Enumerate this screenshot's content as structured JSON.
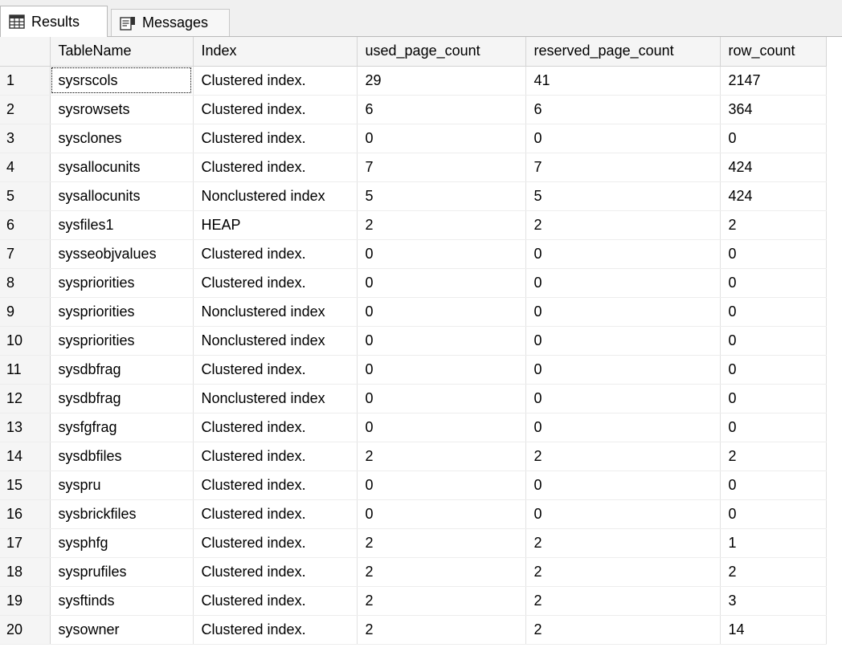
{
  "tabs": {
    "results_label": "Results",
    "messages_label": "Messages"
  },
  "grid": {
    "columns": [
      "TableName",
      "Index",
      "used_page_count",
      "reserved_page_count",
      "row_count"
    ],
    "rows": [
      {
        "n": "1",
        "table": "sysrscols",
        "index": "Clustered index.",
        "used": "29",
        "reserved": "41",
        "rows": "2147"
      },
      {
        "n": "2",
        "table": "sysrowsets",
        "index": "Clustered index.",
        "used": "6",
        "reserved": "6",
        "rows": "364"
      },
      {
        "n": "3",
        "table": "sysclones",
        "index": "Clustered index.",
        "used": "0",
        "reserved": "0",
        "rows": "0"
      },
      {
        "n": "4",
        "table": "sysallocunits",
        "index": "Clustered index.",
        "used": "7",
        "reserved": "7",
        "rows": "424"
      },
      {
        "n": "5",
        "table": "sysallocunits",
        "index": "Nonclustered index",
        "used": "5",
        "reserved": "5",
        "rows": "424"
      },
      {
        "n": "6",
        "table": "sysfiles1",
        "index": "HEAP",
        "used": "2",
        "reserved": "2",
        "rows": "2"
      },
      {
        "n": "7",
        "table": "sysseobjvalues",
        "index": "Clustered index.",
        "used": "0",
        "reserved": "0",
        "rows": "0"
      },
      {
        "n": "8",
        "table": "syspriorities",
        "index": "Clustered index.",
        "used": "0",
        "reserved": "0",
        "rows": "0"
      },
      {
        "n": "9",
        "table": "syspriorities",
        "index": "Nonclustered index",
        "used": "0",
        "reserved": "0",
        "rows": "0"
      },
      {
        "n": "10",
        "table": "syspriorities",
        "index": "Nonclustered index",
        "used": "0",
        "reserved": "0",
        "rows": "0"
      },
      {
        "n": "11",
        "table": "sysdbfrag",
        "index": "Clustered index.",
        "used": "0",
        "reserved": "0",
        "rows": "0"
      },
      {
        "n": "12",
        "table": "sysdbfrag",
        "index": "Nonclustered index",
        "used": "0",
        "reserved": "0",
        "rows": "0"
      },
      {
        "n": "13",
        "table": "sysfgfrag",
        "index": "Clustered index.",
        "used": "0",
        "reserved": "0",
        "rows": "0"
      },
      {
        "n": "14",
        "table": "sysdbfiles",
        "index": "Clustered index.",
        "used": "2",
        "reserved": "2",
        "rows": "2"
      },
      {
        "n": "15",
        "table": "syspru",
        "index": "Clustered index.",
        "used": "0",
        "reserved": "0",
        "rows": "0"
      },
      {
        "n": "16",
        "table": "sysbrickfiles",
        "index": "Clustered index.",
        "used": "0",
        "reserved": "0",
        "rows": "0"
      },
      {
        "n": "17",
        "table": "sysphfg",
        "index": "Clustered index.",
        "used": "2",
        "reserved": "2",
        "rows": "1"
      },
      {
        "n": "18",
        "table": "sysprufiles",
        "index": "Clustered index.",
        "used": "2",
        "reserved": "2",
        "rows": "2"
      },
      {
        "n": "19",
        "table": "sysftinds",
        "index": "Clustered index.",
        "used": "2",
        "reserved": "2",
        "rows": "3"
      },
      {
        "n": "20",
        "table": "sysowner",
        "index": "Clustered index.",
        "used": "2",
        "reserved": "2",
        "rows": "14"
      }
    ]
  }
}
